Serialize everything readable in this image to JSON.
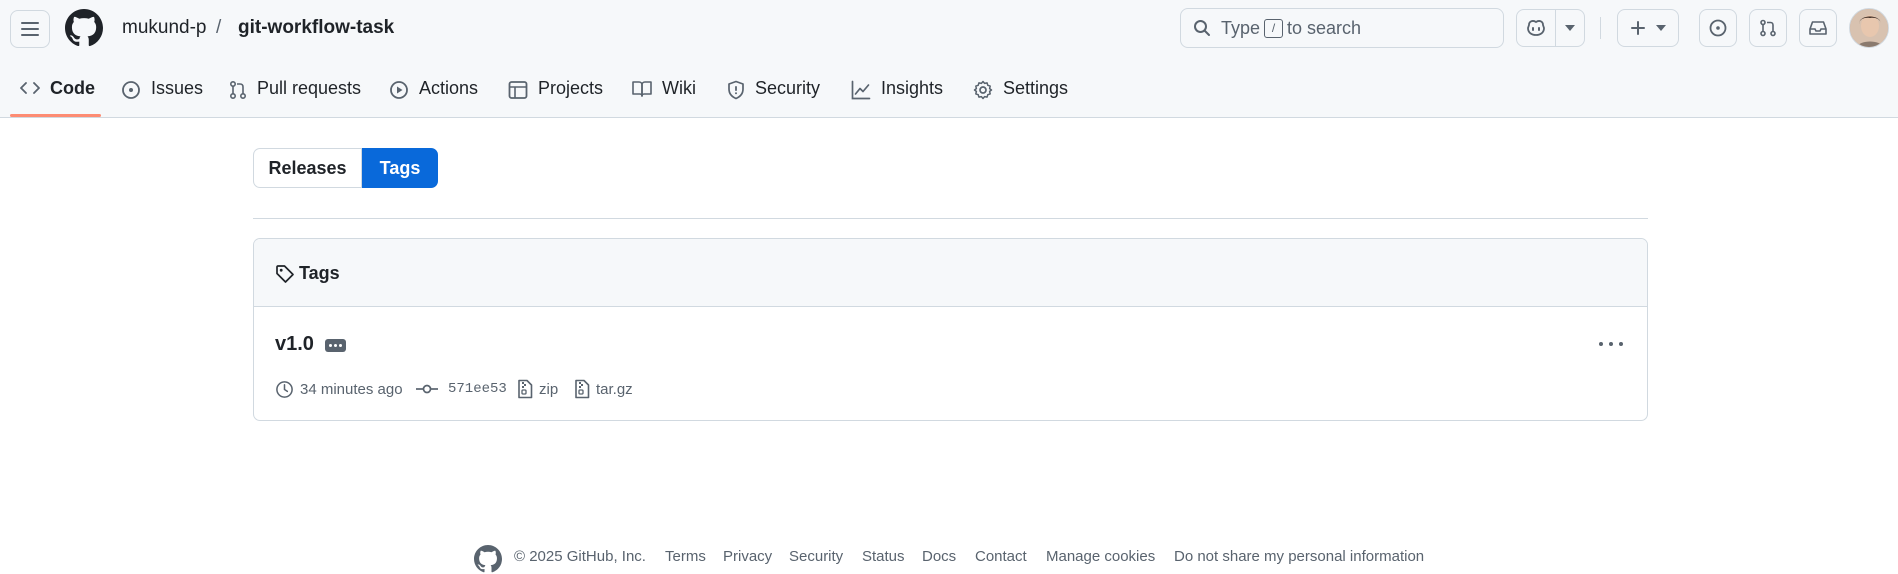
{
  "header": {
    "repo_owner": "mukund-p",
    "repo_separator": "/",
    "repo_name": "git-workflow-task",
    "search": {
      "prefix": "Type",
      "key": "/",
      "suffix": "to search"
    },
    "icons": [
      "menu-icon",
      "github-logo-icon",
      "search-icon",
      "copilot-icon",
      "chevron-down-icon",
      "plus-icon",
      "issues-icon",
      "pull-request-icon",
      "inbox-icon",
      "avatar"
    ]
  },
  "tabs": [
    {
      "label": "Code",
      "icon": "code-icon",
      "selected": true
    },
    {
      "label": "Issues",
      "icon": "issue-opened-icon"
    },
    {
      "label": "Pull requests",
      "icon": "git-pull-request-icon"
    },
    {
      "label": "Actions",
      "icon": "play-icon"
    },
    {
      "label": "Projects",
      "icon": "table-icon"
    },
    {
      "label": "Wiki",
      "icon": "book-icon"
    },
    {
      "label": "Security",
      "icon": "shield-icon"
    },
    {
      "label": "Insights",
      "icon": "graph-icon"
    },
    {
      "label": "Settings",
      "icon": "gear-icon"
    }
  ],
  "segmented": {
    "releases": "Releases",
    "tags": "Tags",
    "selected": "Tags"
  },
  "tags_box": {
    "title": "Tags",
    "items": [
      {
        "name": "v1.0",
        "time": "34 minutes ago",
        "commit": "571ee53",
        "zip": "zip",
        "targz": "tar.gz"
      }
    ]
  },
  "footer": {
    "copyright": "© 2025 GitHub, Inc.",
    "links": [
      "Terms",
      "Privacy",
      "Security",
      "Status",
      "Docs",
      "Contact",
      "Manage cookies",
      "Do not share my personal information"
    ]
  },
  "colors": {
    "accent": "#0969da",
    "tab_underline": "#fd8c73",
    "header_bg": "#f6f8fa",
    "border": "#d1d9e0",
    "muted_text": "#59636e"
  }
}
